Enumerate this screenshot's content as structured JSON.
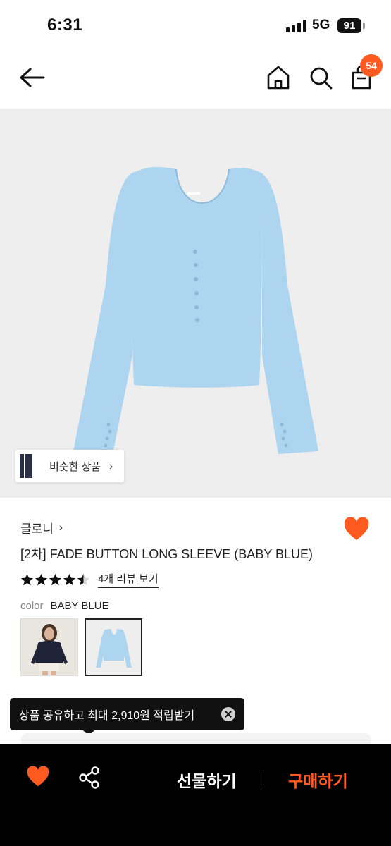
{
  "status_bar": {
    "time": "6:31",
    "network": "5G",
    "battery": "91"
  },
  "header": {
    "cart_count": "54"
  },
  "product": {
    "similar_label": "비슷한 상품",
    "brand": "글로니",
    "title": "[2차] FADE BUTTON LONG SLEEVE (BABY BLUE)",
    "rating": 4.5,
    "review_link": "4개 리뷰 보기",
    "color_key": "color",
    "color_value": "BABY BLUE",
    "garment_color": "#add5f0"
  },
  "tooltip": {
    "text": "상품 공유하고 최대 2,910원 적립받기"
  },
  "bottom_bar": {
    "gift_label": "선물하기",
    "buy_label": "구매하기"
  },
  "colors": {
    "accent": "#ff5a1f",
    "bar": "#000000"
  },
  "icons": [
    "back-arrow-icon",
    "home-icon",
    "search-icon",
    "shopping-bag-icon",
    "heart-icon",
    "share-icon",
    "close-icon",
    "chevron-right-icon",
    "star-icon"
  ]
}
